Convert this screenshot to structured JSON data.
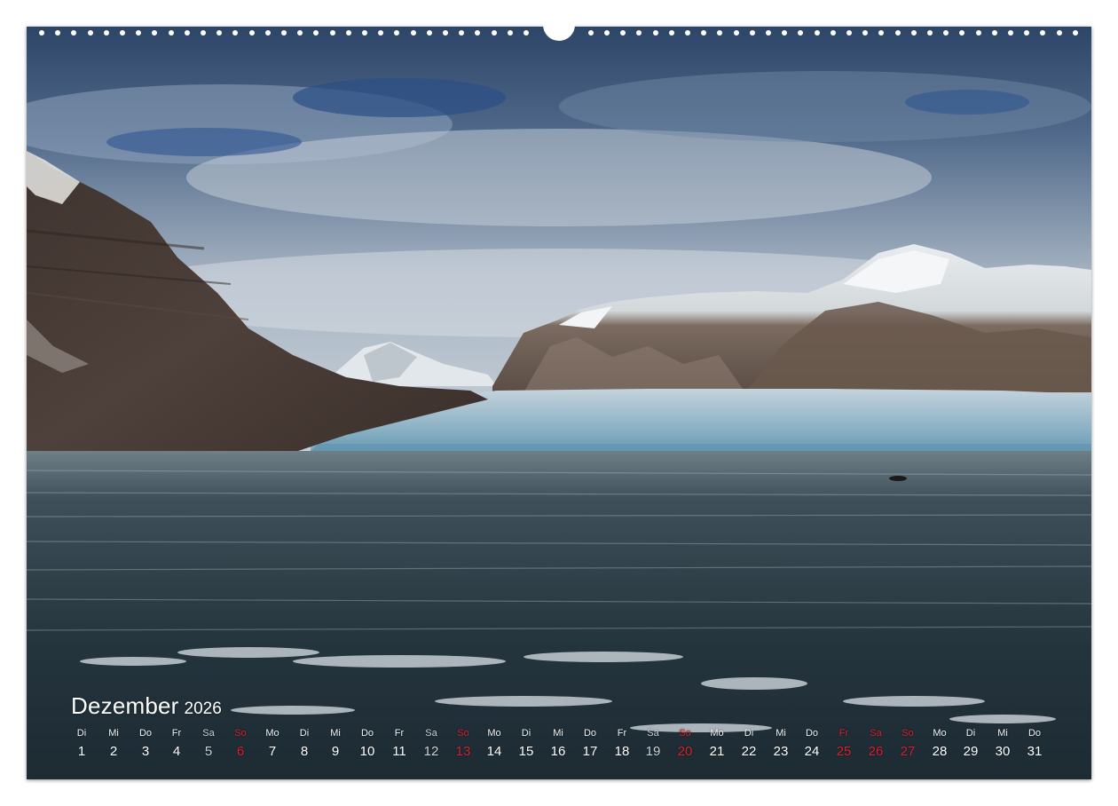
{
  "calendar": {
    "month": "Dezember",
    "year": "2026",
    "days": [
      {
        "wd": "Di",
        "num": "1",
        "kind": "weekday"
      },
      {
        "wd": "Mi",
        "num": "2",
        "kind": "weekday"
      },
      {
        "wd": "Do",
        "num": "3",
        "kind": "weekday"
      },
      {
        "wd": "Fr",
        "num": "4",
        "kind": "weekday"
      },
      {
        "wd": "Sa",
        "num": "5",
        "kind": "saturday"
      },
      {
        "wd": "So",
        "num": "6",
        "kind": "holiday"
      },
      {
        "wd": "Mo",
        "num": "7",
        "kind": "weekday"
      },
      {
        "wd": "Di",
        "num": "8",
        "kind": "weekday"
      },
      {
        "wd": "Mi",
        "num": "9",
        "kind": "weekday"
      },
      {
        "wd": "Do",
        "num": "10",
        "kind": "weekday"
      },
      {
        "wd": "Fr",
        "num": "11",
        "kind": "weekday"
      },
      {
        "wd": "Sa",
        "num": "12",
        "kind": "saturday"
      },
      {
        "wd": "So",
        "num": "13",
        "kind": "holiday"
      },
      {
        "wd": "Mo",
        "num": "14",
        "kind": "weekday"
      },
      {
        "wd": "Di",
        "num": "15",
        "kind": "weekday"
      },
      {
        "wd": "Mi",
        "num": "16",
        "kind": "weekday"
      },
      {
        "wd": "Do",
        "num": "17",
        "kind": "weekday"
      },
      {
        "wd": "Fr",
        "num": "18",
        "kind": "weekday"
      },
      {
        "wd": "Sa",
        "num": "19",
        "kind": "saturday"
      },
      {
        "wd": "So",
        "num": "20",
        "kind": "holiday"
      },
      {
        "wd": "Mo",
        "num": "21",
        "kind": "weekday"
      },
      {
        "wd": "Di",
        "num": "22",
        "kind": "weekday"
      },
      {
        "wd": "Mi",
        "num": "23",
        "kind": "weekday"
      },
      {
        "wd": "Do",
        "num": "24",
        "kind": "weekday"
      },
      {
        "wd": "Fr",
        "num": "25",
        "kind": "holiday"
      },
      {
        "wd": "Sa",
        "num": "26",
        "kind": "holiday"
      },
      {
        "wd": "So",
        "num": "27",
        "kind": "holiday"
      },
      {
        "wd": "Mo",
        "num": "28",
        "kind": "weekday"
      },
      {
        "wd": "Di",
        "num": "29",
        "kind": "weekday"
      },
      {
        "wd": "Mi",
        "num": "30",
        "kind": "weekday"
      },
      {
        "wd": "Do",
        "num": "31",
        "kind": "weekday"
      }
    ]
  },
  "colors": {
    "holiday": "#d8202a",
    "text": "#ffffff"
  }
}
